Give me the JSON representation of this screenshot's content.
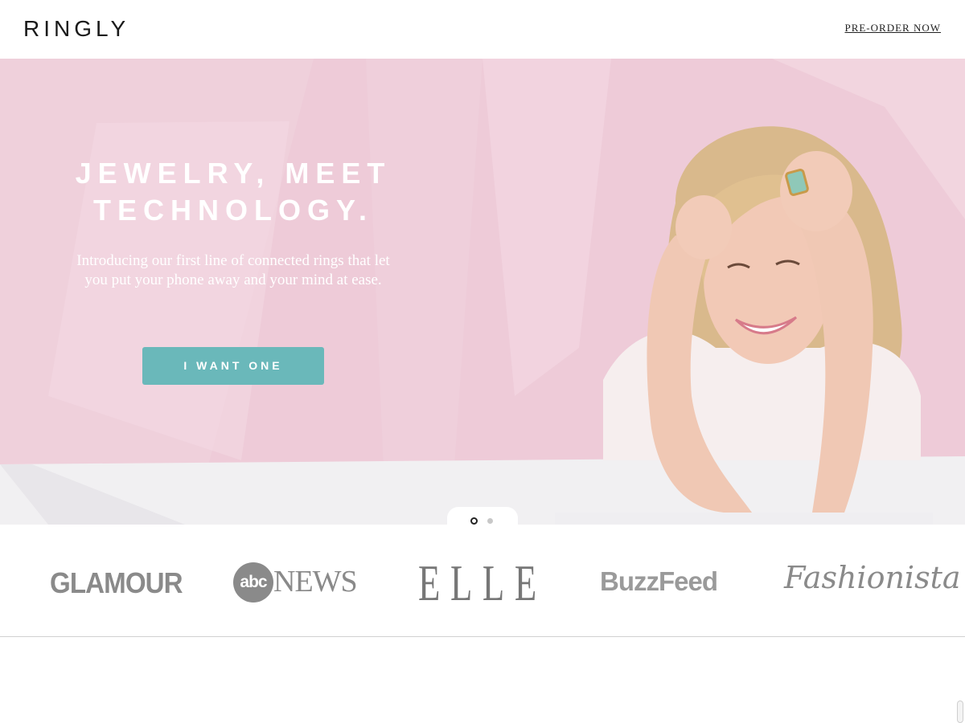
{
  "header": {
    "logo": "RINGLY",
    "preorder_label": "PRE-ORDER NOW"
  },
  "hero": {
    "title_line1": "JEWELRY, MEET",
    "title_line2": "TECHNOLOGY.",
    "subtitle": "Introducing our first line of connected rings that let you put your phone away and your mind at ease.",
    "cta_label": "I WANT ONE",
    "colors": {
      "background": "#eecbd8",
      "cta": "#6ab8ba"
    }
  },
  "slider": {
    "active_index": 0,
    "count": 2
  },
  "press": {
    "logos": [
      {
        "name": "GLAMOUR",
        "label": "GLAMOUR"
      },
      {
        "name": "abc NEWS",
        "mark": "abc",
        "label": "NEWS"
      },
      {
        "name": "ELLE",
        "label": "ELLE"
      },
      {
        "name": "BuzzFeed",
        "label": "BuzzFeed"
      },
      {
        "name": "Fashionista",
        "label": "Fashionista"
      }
    ]
  }
}
